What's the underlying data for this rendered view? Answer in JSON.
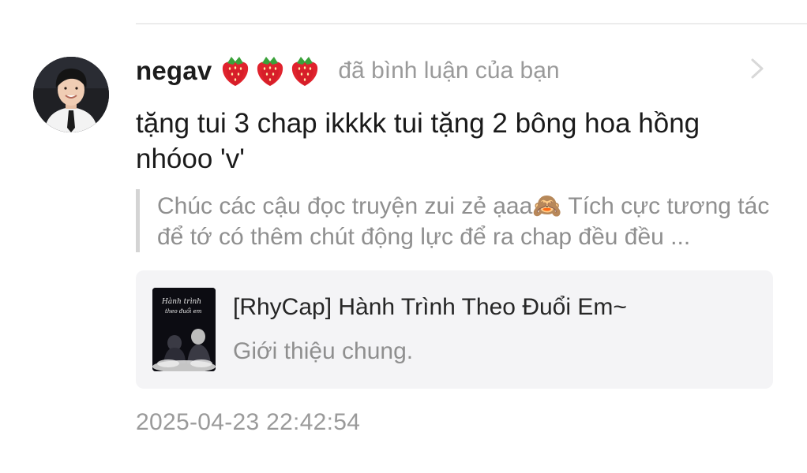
{
  "notification": {
    "user": {
      "name": "negav",
      "badges": [
        "strawberry-icon",
        "strawberry-icon",
        "strawberry-icon"
      ]
    },
    "action_text": "đã bình luận của bạn",
    "comment_text": "tặng tui 3 chap ikkkk tui tặng 2 bông hoa hồng nhóoo 'v'",
    "quoted_text": "Chúc các cậu đọc truyện zui zẻ ạaa🙈 Tích cực tương tác để tớ có thêm chút động lực để ra chap đều đều ...",
    "story": {
      "title": "[RhyCap] Hành Trình Theo Đuổi Em~",
      "subtitle": "Giới thiệu chung.",
      "cover_text_line1": "Hành trình",
      "cover_text_line2": "theo đuổi em"
    },
    "timestamp": "2025-04-23 22:42:54"
  },
  "colors": {
    "username": "#1c1c1c",
    "secondary_text": "#9a9a9a",
    "quote_bar": "#d4d4d4",
    "card_background": "#f4f4f6",
    "divider": "#ececec"
  },
  "icons": {
    "chevron": "chevron-right-icon",
    "avatar": "avatar"
  }
}
